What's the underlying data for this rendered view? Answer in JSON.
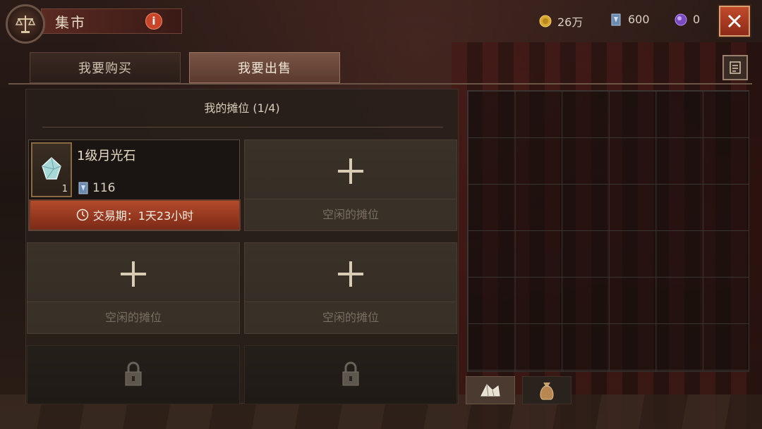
{
  "header": {
    "title": "集市",
    "info": "i",
    "currencies": [
      {
        "icon": "gold-coin-icon",
        "value": "26万"
      },
      {
        "icon": "crystal-card-icon",
        "value": "600"
      },
      {
        "icon": "purple-orb-icon",
        "value": "0"
      }
    ],
    "close": "✕"
  },
  "tabs": [
    {
      "label": "我要购买",
      "active": false
    },
    {
      "label": "我要出售",
      "active": true
    }
  ],
  "stalls": {
    "header": "我的摊位 (1/4)",
    "occupied": {
      "name": "1级月光石",
      "quantity": "1",
      "price": "116",
      "trade_period": "交易期：1天23小时"
    },
    "empty_label": "空闲的摊位"
  },
  "colors": {
    "accent_red": "#b34a2c",
    "gold": "#e0b040",
    "text": "#d8cbb8"
  }
}
